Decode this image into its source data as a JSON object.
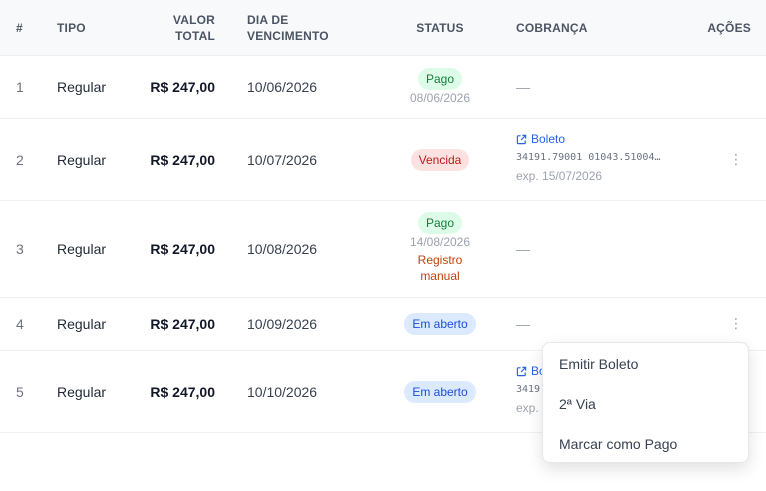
{
  "table": {
    "headers": {
      "index": "#",
      "tipo": "TIPO",
      "valor_line1": "VALOR",
      "valor_line2": "TOTAL",
      "venc_line1": "DIA DE",
      "venc_line2": "VENCIMENTO",
      "status": "STATUS",
      "cobranca": "COBRANÇA",
      "acoes": "AÇÕES"
    },
    "rows": [
      {
        "index": "1",
        "tipo": "Regular",
        "valor": "R$ 247,00",
        "vencimento": "10/06/2026",
        "status": "Pago",
        "status_date": "08/06/2026",
        "cobranca": "—"
      },
      {
        "index": "2",
        "tipo": "Regular",
        "valor": "R$ 247,00",
        "vencimento": "10/07/2026",
        "status": "Vencida",
        "boleto_link": "Boleto",
        "boleto_code": "34191.79001 01043.51004…",
        "boleto_exp": "exp. 15/07/2026",
        "actions": "⋮"
      },
      {
        "index": "3",
        "tipo": "Regular",
        "valor": "R$ 247,00",
        "vencimento": "10/08/2026",
        "status": "Pago",
        "status_date": "14/08/2026",
        "manual_line1": "Registro",
        "manual_line2": "manual",
        "cobranca": "—"
      },
      {
        "index": "4",
        "tipo": "Regular",
        "valor": "R$ 247,00",
        "vencimento": "10/09/2026",
        "status": "Em aberto",
        "cobranca": "—",
        "actions": "⋮"
      },
      {
        "index": "5",
        "tipo": "Regular",
        "valor": "R$ 247,00",
        "vencimento": "10/10/2026",
        "status": "Em aberto",
        "boleto_link": "Bo",
        "boleto_code": "3419",
        "boleto_exp": "exp."
      }
    ]
  },
  "menu": {
    "items": [
      "Emitir Boleto",
      "2ª Via",
      "Marcar como Pago"
    ]
  },
  "colors": {
    "pago": "#15803d",
    "vencida": "#b91c1c",
    "aberto": "#1d4ed8",
    "link": "#2563eb",
    "manual": "#c2410c"
  }
}
